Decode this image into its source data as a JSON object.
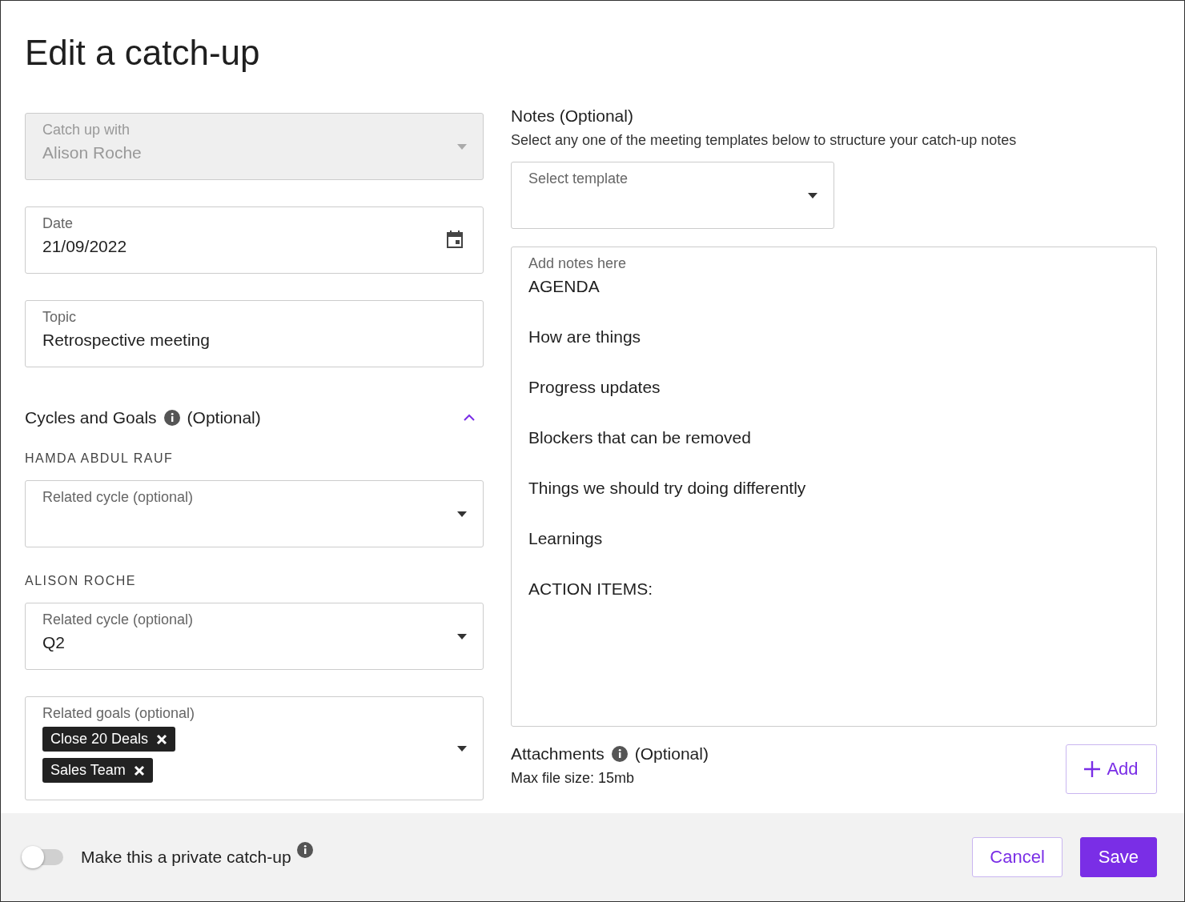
{
  "title": "Edit a catch-up",
  "catch_up_with": {
    "label": "Catch up with",
    "value": "Alison Roche",
    "disabled": true
  },
  "date": {
    "label": "Date",
    "value": "21/09/2022"
  },
  "topic": {
    "label": "Topic",
    "value": "Retrospective meeting"
  },
  "cycles_goals": {
    "title": "Cycles and Goals",
    "optional": "(Optional)",
    "expanded": true,
    "people": [
      {
        "name": "HAMDA ABDUL RAUF",
        "cycle": {
          "label": "Related cycle (optional)"
        }
      },
      {
        "name": "ALISON ROCHE",
        "cycle": {
          "label": "Related cycle (optional)",
          "value": "Q2"
        }
      }
    ],
    "goals": {
      "label": "Related goals (optional)",
      "chips": [
        "Close 20 Deals",
        "Sales Team"
      ]
    }
  },
  "notes": {
    "title": "Notes",
    "optional": "(Optional)",
    "description": "Select any one of the meeting templates below to structure your catch-up notes",
    "template": {
      "placeholder": "Select template"
    },
    "editor": {
      "label": "Add notes here",
      "lines": [
        "AGENDA",
        "How are things",
        "Progress updates",
        "Blockers that can be removed",
        "Things we should try doing differently",
        "Learnings",
        "ACTION ITEMS:"
      ]
    }
  },
  "attachments": {
    "title": "Attachments",
    "optional": "(Optional)",
    "hint": "Max file size: 15mb",
    "add_button": "Add"
  },
  "footer": {
    "private": {
      "label": "Make this a private catch-up",
      "on": false
    },
    "buttons": [
      {
        "label": "Cancel",
        "kind": "secondary"
      },
      {
        "label": "Save",
        "kind": "primary"
      }
    ]
  }
}
